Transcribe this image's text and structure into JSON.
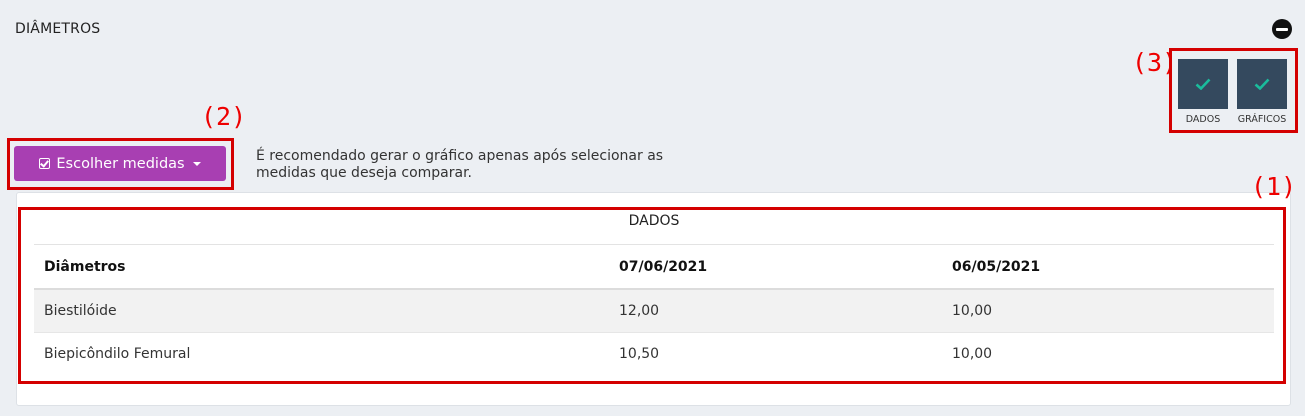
{
  "section": {
    "title": "DIÂMETROS"
  },
  "annotations": {
    "one": "(1)",
    "two": "(2)",
    "three": "(3)"
  },
  "toggles": [
    {
      "label": "DADOS",
      "checked": true
    },
    {
      "label": "GRÁFICOS",
      "checked": true
    }
  ],
  "choose_button": {
    "label": "Escolher medidas"
  },
  "hint": "É recomendado gerar o gráfico apenas após selecionar as medidas que deseja comparar.",
  "table": {
    "caption": "DADOS",
    "headers": [
      "Diâmetros",
      "07/06/2021",
      "06/05/2021"
    ],
    "rows": [
      [
        "Biestilóide",
        "12,00",
        "10,00"
      ],
      [
        "Biepicôndilo Femural",
        "10,50",
        "10,00"
      ]
    ]
  },
  "colors": {
    "accent_button": "#a83fb2",
    "toggle_bg": "#34495e",
    "check": "#1abc9c",
    "annotation": "#d40000"
  }
}
